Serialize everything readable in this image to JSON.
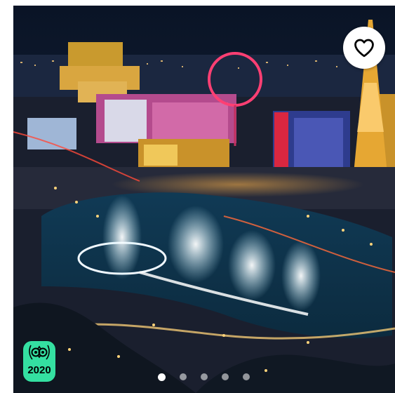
{
  "listing": {
    "photo_description_icon": "city-night-photo",
    "favorite_icon": "heart-outline-icon",
    "award_badge": {
      "icon": "owl-eyes-icon",
      "year": "2020",
      "color": "#34e0a1"
    },
    "carousel": {
      "total": 5,
      "active_index": 0
    }
  }
}
